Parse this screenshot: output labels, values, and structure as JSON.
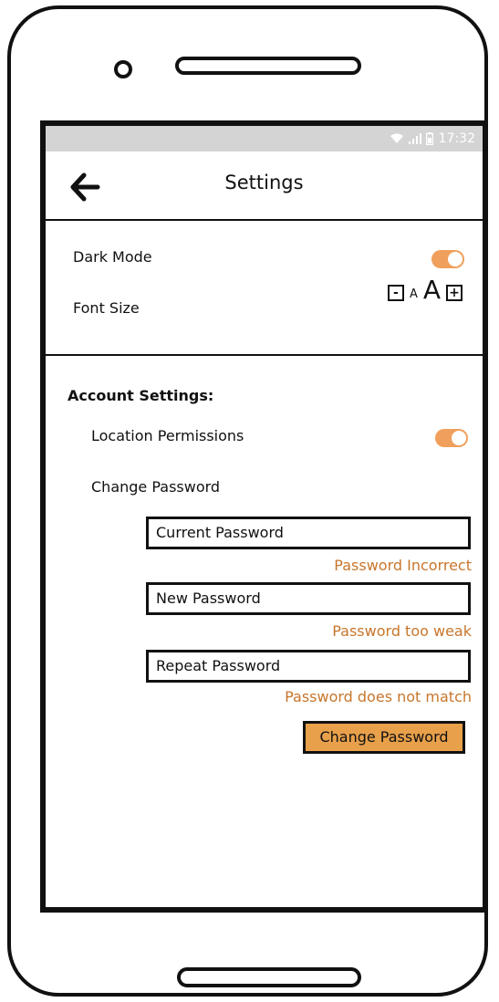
{
  "status_bar": {
    "time": "17:32"
  },
  "header": {
    "title": "Settings",
    "back_icon": "arrow-left-icon"
  },
  "display_settings": {
    "dark_mode_label": "Dark Mode",
    "dark_mode_on": true,
    "font_size_label": "Font Size",
    "font_decrease": "-",
    "font_small_sample": "A",
    "font_large_sample": "A",
    "font_increase": "+"
  },
  "account": {
    "header": "Account Settings:",
    "location_label": "Location Permissions",
    "location_on": true,
    "change_password_label": "Change Password",
    "current_password_placeholder": "Current Password",
    "current_password_error": "Password Incorrect",
    "new_password_placeholder": "New Password",
    "new_password_error": "Password too weak",
    "repeat_password_placeholder": "Repeat Password",
    "repeat_password_error": "Password does not match",
    "submit_label": "Change Password"
  },
  "colors": {
    "accent": "#e8a04a",
    "toggle_on": "#f0a05c",
    "error": "#c8762c",
    "status_bar": "#d4d4d4"
  }
}
